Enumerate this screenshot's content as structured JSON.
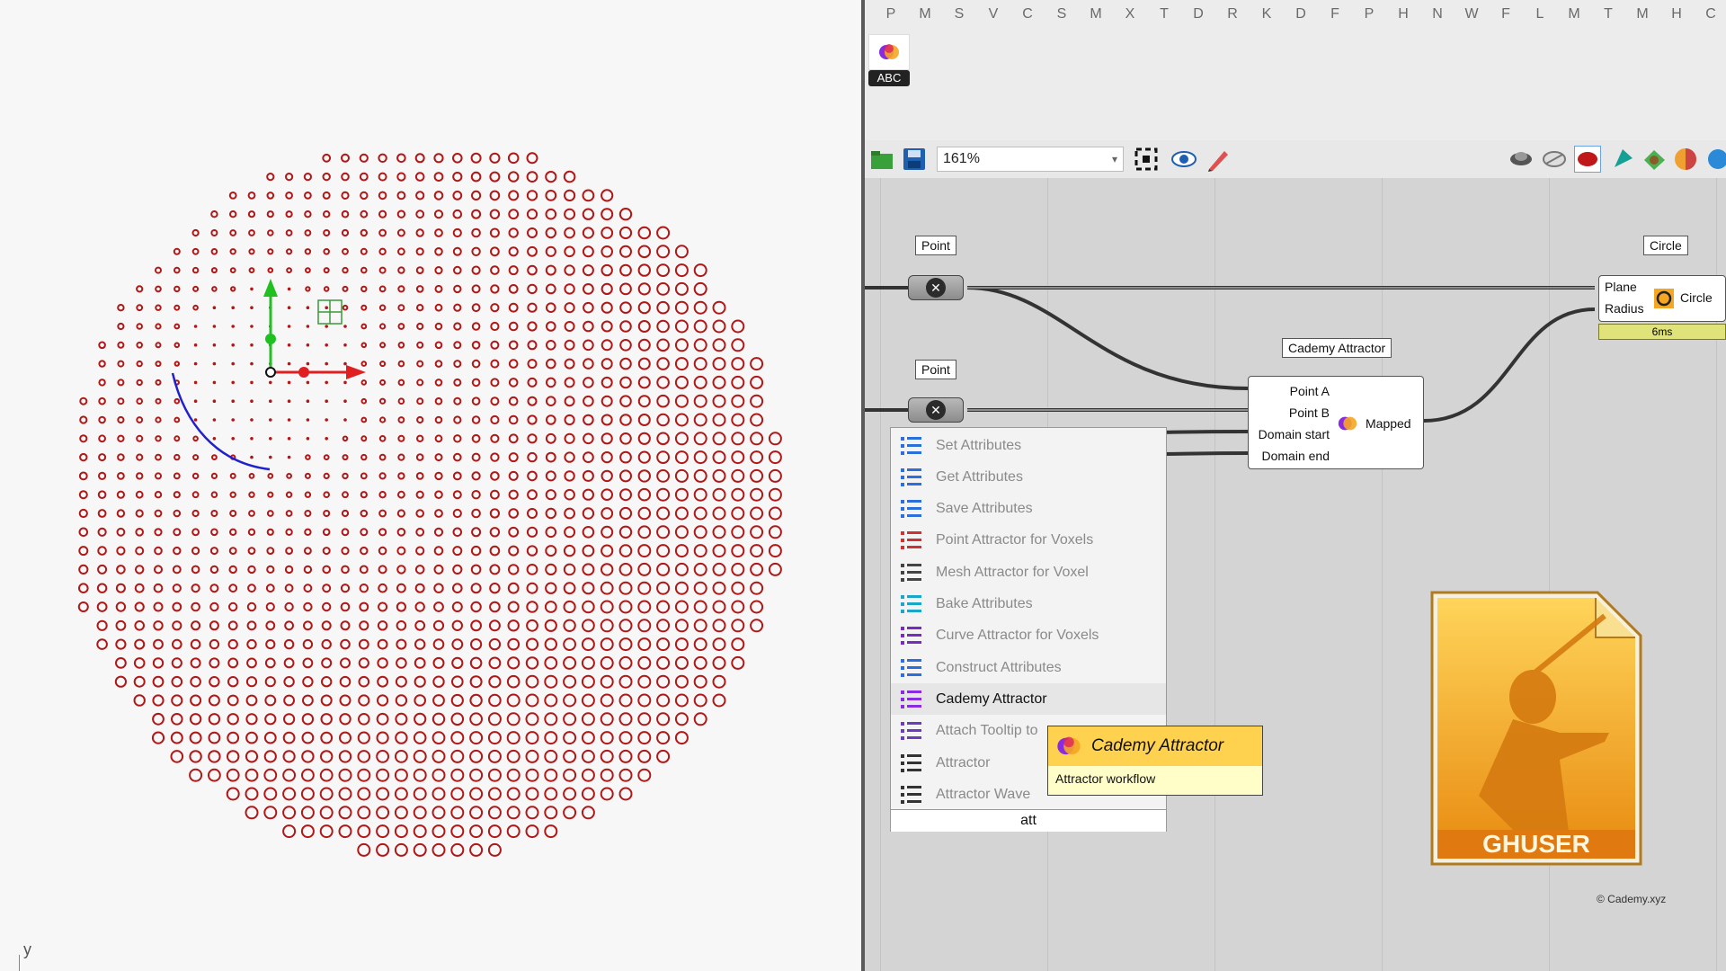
{
  "rhino": {
    "axis_label": "y",
    "colors": {
      "points": "#b01818",
      "curve": "#2020cc",
      "gumball_x": "#e02020",
      "gumball_y": "#20c020",
      "cplane": "#3a9a3a"
    }
  },
  "gh": {
    "tabs": [
      "P",
      "M",
      "S",
      "V",
      "C",
      "S",
      "M",
      "X",
      "T",
      "D",
      "R",
      "K",
      "D",
      "F",
      "P",
      "H",
      "N",
      "W",
      "F",
      "L",
      "M",
      "T",
      "M",
      "H",
      "C"
    ],
    "ribbon": {
      "plugin_label": "ABC",
      "plugin_icon": "cademy-icon"
    },
    "toolbar": {
      "zoom": "161%"
    },
    "nodes": {
      "point1_label": "Point",
      "point2_label": "Point",
      "attractor_label": "Cademy Attractor",
      "attractor_inputs": [
        "Point A",
        "Point B",
        "Domain start",
        "Domain end"
      ],
      "attractor_output": "Mapped",
      "circle_label": "Circle",
      "circle_inputs": [
        "Plane",
        "Radius"
      ],
      "circle_output": "Circle",
      "circle_time": "6ms"
    },
    "search": {
      "items": [
        {
          "label": "Set Attributes",
          "icon": "set-attributes-icon"
        },
        {
          "label": "Get Attributes",
          "icon": "get-attributes-icon"
        },
        {
          "label": "Save Attributes",
          "icon": "save-attributes-icon"
        },
        {
          "label": "Point Attractor for Voxels",
          "icon": "point-attractor-icon"
        },
        {
          "label": "Mesh Attractor for Voxel",
          "icon": "mesh-attractor-icon"
        },
        {
          "label": "Bake Attributes",
          "icon": "bake-attributes-icon"
        },
        {
          "label": "Curve Attractor for Voxels",
          "icon": "curve-attractor-icon"
        },
        {
          "label": "Construct Attributes",
          "icon": "construct-attributes-icon"
        },
        {
          "label": "Cademy Attractor",
          "icon": "cademy-attractor-icon"
        },
        {
          "label": "Attach Tooltip to",
          "icon": "attach-tooltip-icon"
        },
        {
          "label": "Attractor",
          "icon": "attractor-icon"
        },
        {
          "label": "Attractor Wave",
          "icon": "attractor-wave-icon"
        }
      ],
      "query": "att"
    },
    "tooltip": {
      "title": "Cademy Attractor",
      "description": "Attractor workflow"
    },
    "ghuser_label": "GHUSER",
    "copyright": "© Cademy.xyz"
  }
}
